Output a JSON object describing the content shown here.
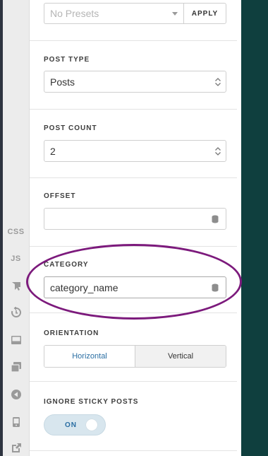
{
  "leftbar": {
    "tools": [
      {
        "label": "CSS",
        "icon": "css-text"
      },
      {
        "label": "JS",
        "icon": "js-text"
      },
      {
        "label": "",
        "icon": "cursor-icon"
      },
      {
        "label": "",
        "icon": "history-icon"
      },
      {
        "label": "",
        "icon": "footer-bar-icon"
      },
      {
        "label": "",
        "icon": "copy-icon"
      },
      {
        "label": "",
        "icon": "back-circle-icon"
      },
      {
        "label": "",
        "icon": "mobile-icon"
      },
      {
        "label": "",
        "icon": "external-link-icon"
      }
    ]
  },
  "presets": {
    "placeholder": "No Presets",
    "apply_label": "APPLY"
  },
  "post_type": {
    "label": "POST TYPE",
    "value": "Posts"
  },
  "post_count": {
    "label": "POST COUNT",
    "value": "2"
  },
  "offset": {
    "label": "OFFSET",
    "value": ""
  },
  "category": {
    "label": "CATEGORY",
    "value": "category_name"
  },
  "orientation": {
    "label": "ORIENTATION",
    "options": [
      "Horizontal",
      "Vertical"
    ],
    "selected": "Horizontal"
  },
  "ignore_sticky": {
    "label": "IGNORE STICKY POSTS",
    "toggle_label": "ON",
    "state": "on"
  },
  "colors": {
    "accent": "#2a6ea3",
    "highlight_oval": "#7c1a7c",
    "right_panel": "#0f3f3e"
  }
}
